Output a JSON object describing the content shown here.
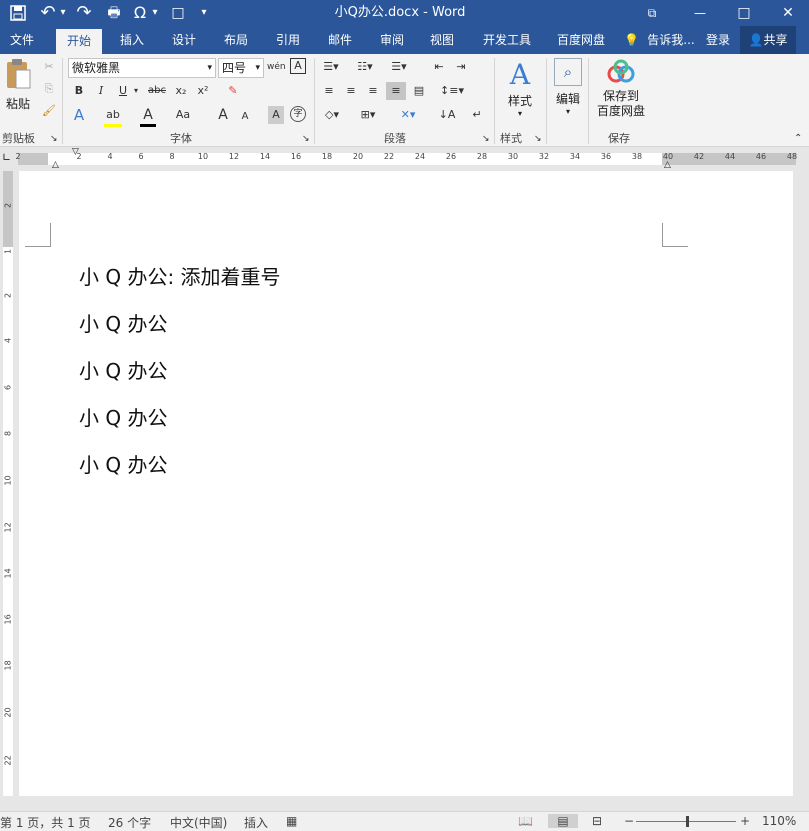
{
  "window": {
    "title": "小Q办公.docx - Word"
  },
  "quick_access": {
    "save_icon": "💾",
    "undo_icon": "↶",
    "redo_icon": "↷",
    "print_icon": "🖶",
    "omega_icon": "Ω",
    "new_icon": "□",
    "customize": "▾"
  },
  "window_controls": {
    "restore": "⧉",
    "minimize": "—",
    "maximize": "□",
    "close": "✕"
  },
  "tabs": [
    "文件",
    "开始",
    "插入",
    "设计",
    "布局",
    "引用",
    "邮件",
    "审阅",
    "视图",
    "开发工具",
    "百度网盘"
  ],
  "tell_me": "告诉我...",
  "signin": "登录",
  "share": "共享",
  "ribbon": {
    "clipboard": {
      "label": "剪贴板",
      "paste": "粘贴"
    },
    "font": {
      "label": "字体",
      "name": "微软雅黑",
      "size": "四号",
      "bold": "B",
      "italic": "I",
      "underline": "U",
      "strike": "abc",
      "sub": "x₂",
      "sup": "x²",
      "grow": "A",
      "shrink": "A",
      "aa": "Aa",
      "clear": "✎",
      "char_border": "A",
      "char_shade": "A",
      "phonetic": "wén",
      "enclose": "字"
    },
    "paragraph": {
      "label": "段落"
    },
    "styles": {
      "label": "样式",
      "btn": "样式"
    },
    "editing": {
      "btn": "编辑"
    },
    "save": {
      "label": "保存",
      "btn": "保存到\n百度网盘"
    }
  },
  "ruler": {
    "h_ticks": [
      "2",
      "2",
      "4",
      "6",
      "8",
      "10",
      "12",
      "14",
      "16",
      "18",
      "20",
      "22",
      "24",
      "26",
      "28",
      "30",
      "32",
      "34",
      "36",
      "38",
      "40",
      "42",
      "44",
      "46",
      "48"
    ],
    "v_ticks": [
      "2",
      "1",
      "2",
      "4",
      "6",
      "8",
      "10",
      "12",
      "14",
      "16",
      "18",
      "20",
      "22"
    ]
  },
  "document": {
    "lines": [
      "小 Q 办公:   添加着重号",
      "小 Q 办公",
      "小 Q 办公",
      "小 Q 办公",
      "小 Q 办公"
    ]
  },
  "status": {
    "page": "第 1 页，共 1 页",
    "words": "26 个字",
    "lang": "中文(中国)",
    "insert": "插入",
    "zoom": "110%"
  }
}
